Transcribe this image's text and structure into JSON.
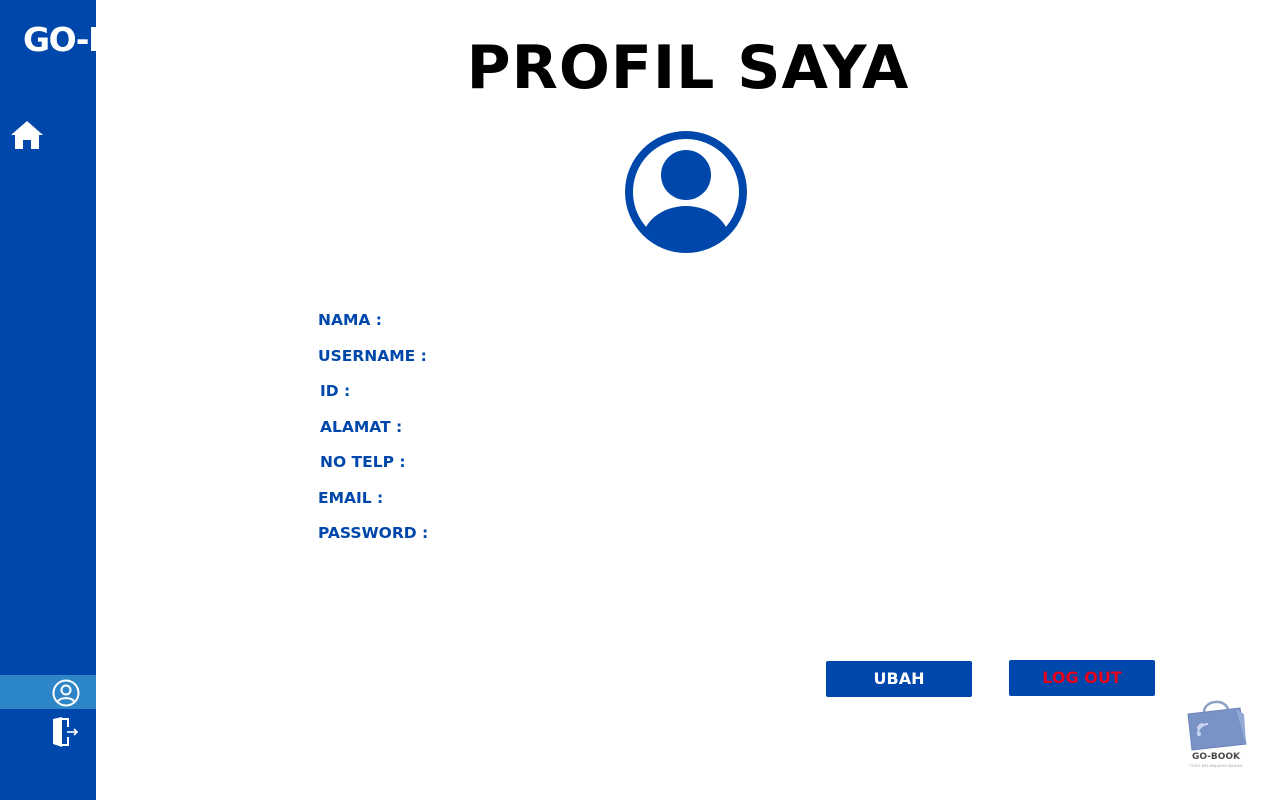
{
  "brand": {
    "name": "GO-BOOK"
  },
  "sidebar": {
    "items": [
      {
        "icon": "home-icon",
        "active": false
      },
      {
        "icon": "user-icon",
        "active": true
      },
      {
        "icon": "logout-door-icon",
        "active": false
      }
    ]
  },
  "page": {
    "title": "PROFIL SAYA"
  },
  "profile": {
    "avatar_icon": "user-circle-icon",
    "fields": [
      {
        "label": "NAMA :"
      },
      {
        "label": "USERNAME :"
      },
      {
        "label": "ID :"
      },
      {
        "label": "ALAMAT :"
      },
      {
        "label": "NO TELP :"
      },
      {
        "label": "EMAIL :"
      },
      {
        "label": "PASSWORD :"
      }
    ]
  },
  "actions": {
    "edit_label": "UBAH",
    "logout_label": "LOG OUT"
  },
  "corner_logo": {
    "name": "GO-BOOK",
    "tagline": "TOKO BELANJANYA BAHAN"
  },
  "colors": {
    "primary": "#0047ab",
    "sidebar_active": "#2d86c7",
    "logout_text": "#e8001c",
    "title": "#000000"
  }
}
